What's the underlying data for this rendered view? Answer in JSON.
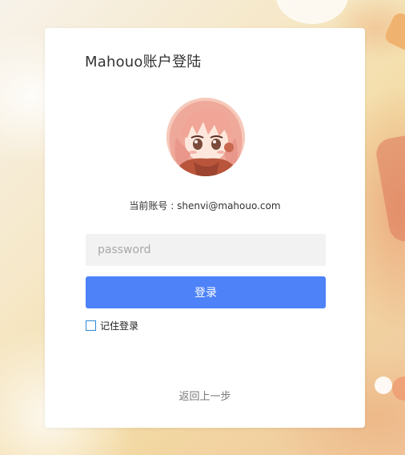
{
  "title": "Mahouo账户登陆",
  "account": {
    "label": "当前账号 : ",
    "email": "shenvi@mahouo.com"
  },
  "password_field": {
    "placeholder": "password",
    "value": ""
  },
  "login_button_label": "登录",
  "remember": {
    "label": "记住登录",
    "checked": false
  },
  "back_link_label": "返回上一步",
  "colors": {
    "primary_button": "#4e82f9",
    "checkbox_border": "#2a89d8",
    "card_background": "#ffffff"
  },
  "icons": {
    "avatar": "anime-girl-avatar"
  }
}
